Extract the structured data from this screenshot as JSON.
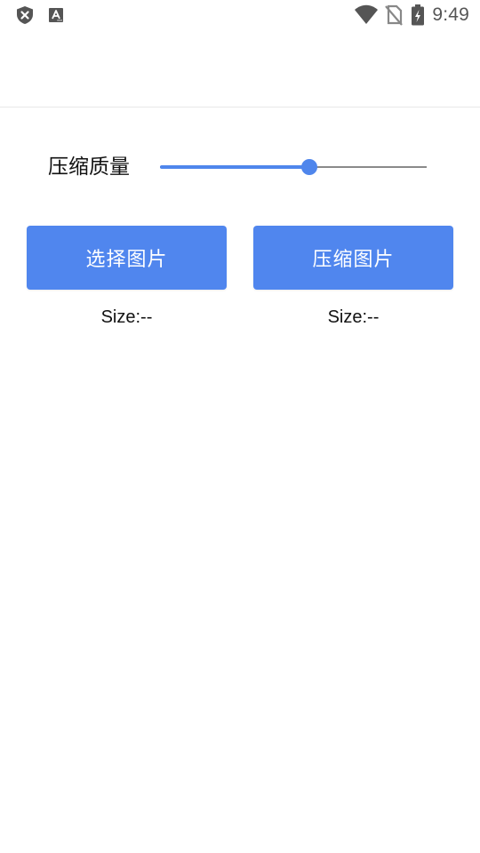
{
  "status_bar": {
    "time": "9:49",
    "left_icons": [
      "shield-close-icon",
      "text-a-icon"
    ],
    "right_icons": [
      "wifi-icon",
      "no-sim-icon",
      "battery-charging-icon"
    ]
  },
  "quality": {
    "label": "压缩质量",
    "value_fraction": 0.56
  },
  "buttons": {
    "select_label": "选择图片",
    "compress_label": "压缩图片"
  },
  "sizes": {
    "original": "Size:--",
    "compressed": "Size:--"
  },
  "colors": {
    "accent": "#5086ee",
    "track": "#8a8a8a",
    "background": "#ffffff"
  }
}
